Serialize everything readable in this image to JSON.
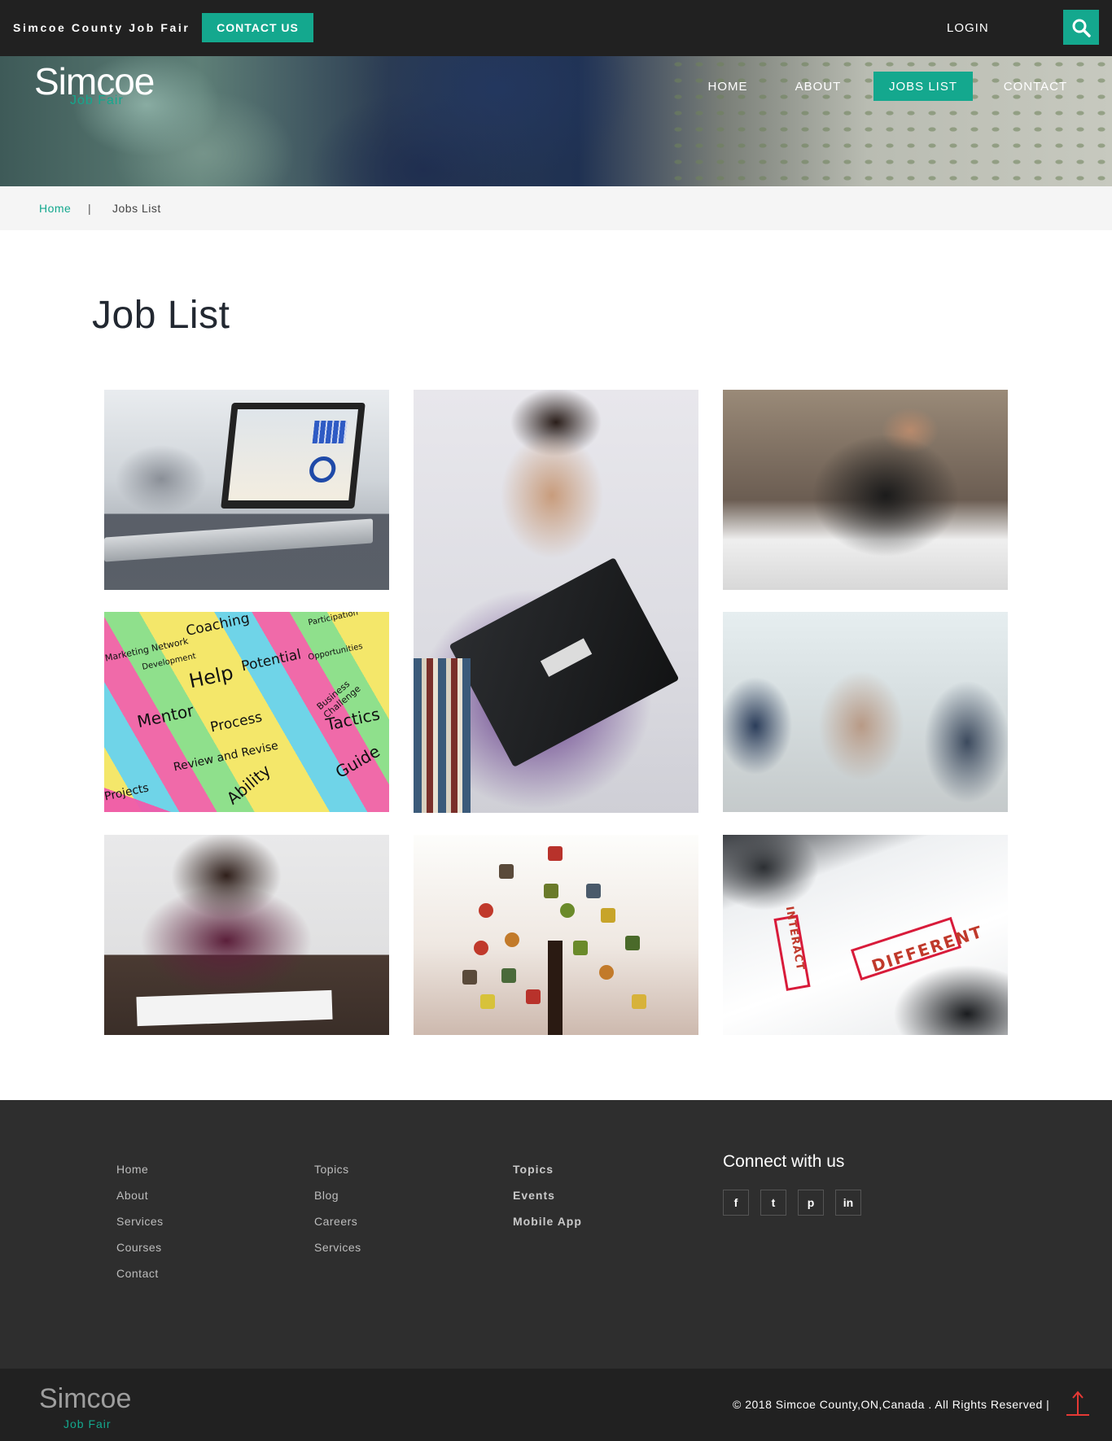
{
  "topbar": {
    "site_name": "Simcoe County Job Fair",
    "contact_label": "CONTACT US",
    "login_label": "LOGIN",
    "search_icon": "search-icon"
  },
  "logo": {
    "main": "Simcoe",
    "sub": "Job Fair"
  },
  "nav": {
    "items": [
      {
        "label": "HOME"
      },
      {
        "label": "ABOUT"
      },
      {
        "label": "JOBS LIST",
        "active": true
      },
      {
        "label": "CONTACT"
      }
    ]
  },
  "breadcrumb": {
    "home": "Home",
    "separator": "|",
    "current": "Jobs List"
  },
  "main": {
    "title": "Job List",
    "postit_words": [
      "Coaching",
      "Help",
      "Potential",
      "Mentor",
      "Process",
      "Tactics",
      "Review and Revise",
      "Guide",
      "Ability",
      "Projects",
      "Development",
      "Participation",
      "Opportunities",
      "Business Challenge",
      "Marketing Network"
    ],
    "brainstorm_words": [
      "INTERACT",
      "DIFFERENT"
    ]
  },
  "footer": {
    "col1": [
      "Home",
      "About",
      "Services",
      "Courses",
      "Contact"
    ],
    "col2": [
      "Topics",
      "Blog",
      "Careers",
      "Services"
    ],
    "col3": [
      "Topics",
      "Events",
      "Mobile App"
    ],
    "connect_title": "Connect with us",
    "social": [
      {
        "label": "f",
        "icon": "facebook-icon"
      },
      {
        "label": "t",
        "icon": "twitter-icon"
      },
      {
        "label": "p",
        "icon": "pinterest-icon"
      },
      {
        "label": "in",
        "icon": "linkedin-icon"
      }
    ]
  },
  "bottombar": {
    "logo_main": "Simcoe",
    "logo_sub": "Job Fair",
    "copyright": "© 2018 Simcoe County,ON,Canada . All Rights Reserved |"
  },
  "colors": {
    "accent": "#14a88e",
    "dark": "#212121",
    "footer_bg": "#2e2e2e",
    "breadcrumb_bg": "#f5f5f5",
    "up_arrow": "#e53935"
  }
}
